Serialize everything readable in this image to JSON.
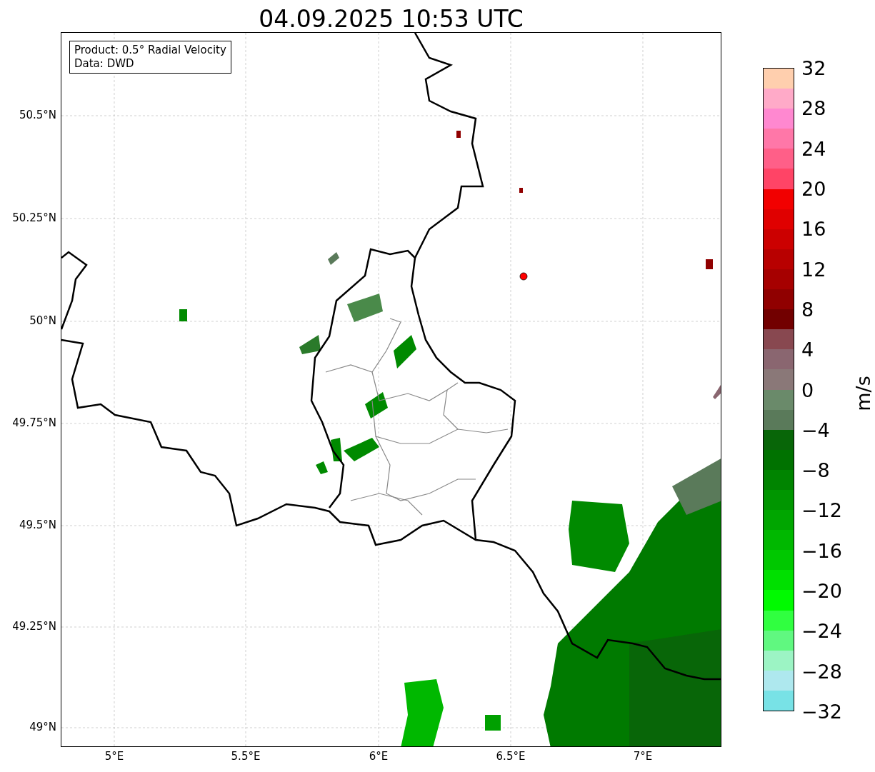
{
  "title": "04.09.2025 10:53 UTC",
  "info_box": [
    "Product: 0.5° Radial Velocity",
    "Data: DWD"
  ],
  "map": {
    "kind": "map",
    "y_ticks": [
      "50.5°N",
      "50.25°N",
      "50°N",
      "49.75°N",
      "49.5°N",
      "49.25°N",
      "49°N"
    ],
    "x_ticks": [
      "5°E",
      "5.5°E",
      "6°E",
      "6.5°E",
      "7°E"
    ]
  },
  "colorbar": {
    "label": "m/s",
    "ticks": [
      "32",
      "28",
      "24",
      "20",
      "16",
      "12",
      "8",
      "4",
      "0",
      "−4",
      "−8",
      "−12",
      "−16",
      "−20",
      "−24",
      "−28",
      "−32"
    ],
    "segments": [
      {
        "color": "#ffcfae"
      },
      {
        "color": "#ffaac8"
      },
      {
        "color": "#ff88d0"
      },
      {
        "color": "#ff77a8"
      },
      {
        "color": "#ff5f88"
      },
      {
        "color": "#ff4466"
      },
      {
        "color": "#f20000"
      },
      {
        "color": "#e00000"
      },
      {
        "color": "#cc0000"
      },
      {
        "color": "#b80000"
      },
      {
        "color": "#a60000"
      },
      {
        "color": "#900000"
      },
      {
        "color": "#720000"
      },
      {
        "color": "#884850"
      },
      {
        "color": "#8a6670"
      },
      {
        "color": "#8a7878"
      },
      {
        "color": "#6a8a6a"
      },
      {
        "color": "#5a7a5a"
      },
      {
        "color": "#086608"
      },
      {
        "color": "#007200"
      },
      {
        "color": "#008400"
      },
      {
        "color": "#009600"
      },
      {
        "color": "#00a600"
      },
      {
        "color": "#00b800"
      },
      {
        "color": "#00c800"
      },
      {
        "color": "#00e000"
      },
      {
        "color": "#00fa00"
      },
      {
        "color": "#30ff40"
      },
      {
        "color": "#60f880"
      },
      {
        "color": "#9cf4c4"
      },
      {
        "color": "#aee8ee"
      },
      {
        "color": "#78e2e6"
      }
    ]
  }
}
